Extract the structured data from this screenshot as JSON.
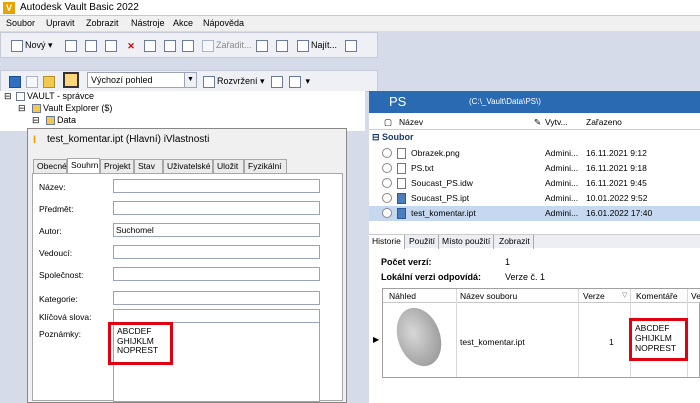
{
  "app": {
    "title": "Autodesk Vault Basic 2022",
    "logo": "V"
  },
  "menu": [
    "Soubor",
    "Upravit",
    "Zobrazit",
    "Nástroje",
    "Akce",
    "Nápověda"
  ],
  "toolbar": {
    "new_label": "Nový",
    "assign_label": "Zařadit...",
    "find_label": "Najít..."
  },
  "toolbar2": {
    "view_value": "Výchozí pohled",
    "layout_label": "Rozvržení"
  },
  "tree": {
    "root": "VAULT - správce",
    "explorer": "Vault Explorer ($)",
    "data": "Data"
  },
  "dialog": {
    "title": "test_komentar.ipt (Hlavní) iVlastnosti",
    "icon": "I",
    "tabs": [
      "Obecné",
      "Souhrn",
      "Projekt",
      "Stav",
      "Uživatelské",
      "Uložit",
      "Fyzikální"
    ],
    "active_tab": 1,
    "fields": [
      {
        "label": "Název:",
        "value": ""
      },
      {
        "label": "Předmět:",
        "value": ""
      },
      {
        "label": "Autor:",
        "value": "Suchomel"
      },
      {
        "label": "Vedoucí:",
        "value": ""
      },
      {
        "label": "Společnost:",
        "value": ""
      },
      {
        "label": "Kategorie:",
        "value": ""
      },
      {
        "label": "Klíčová slova:",
        "value": ""
      }
    ],
    "notes_label": "Poznámky:",
    "notes_value": "ABCDEF\nGHIJKLM\nNOPREST"
  },
  "folder": {
    "name": "PS",
    "path": "(C:\\_Vault\\Data\\PS\\)",
    "columns": [
      "Název",
      "Vytv...",
      "Zařazeno"
    ],
    "group": "Soubor",
    "files": [
      {
        "name": "Obrazek.png",
        "creator": "Admini...",
        "date": "16.11.2021 9:12",
        "type": "file"
      },
      {
        "name": "PS.txt",
        "creator": "Admini...",
        "date": "16.11.2021 9:18",
        "type": "file"
      },
      {
        "name": "Soucast_PS.idw",
        "creator": "Admini...",
        "date": "16.11.2021 9:45",
        "type": "file"
      },
      {
        "name": "Soucast_PS.ipt",
        "creator": "Admini...",
        "date": "10.01.2022 9:52",
        "type": "part"
      },
      {
        "name": "test_komentar.ipt",
        "creator": "Admini...",
        "date": "16.01.2022 17:40",
        "type": "part",
        "selected": true
      }
    ]
  },
  "bottom": {
    "tabs": [
      "Historie",
      "Použití",
      "Místo použití",
      "Zobrazit"
    ],
    "active_tab": 0,
    "version_count_label": "Počet verzí:",
    "version_count_value": "1",
    "local_label": "Lokální verzi odpovídá:",
    "local_value": "Verze č. 1",
    "table_headers": [
      "Náhled",
      "Název souboru",
      "Verze",
      "Komentáře",
      "Ve"
    ],
    "row": {
      "file": "test_komentar.ipt",
      "version": "1",
      "comment": "ABCDEF\nGHIJKLM\nNOPREST"
    }
  },
  "colors": {
    "highlight": "#e00010",
    "folder_header": "#2a6ab2",
    "selection": "#c5d8ef"
  }
}
